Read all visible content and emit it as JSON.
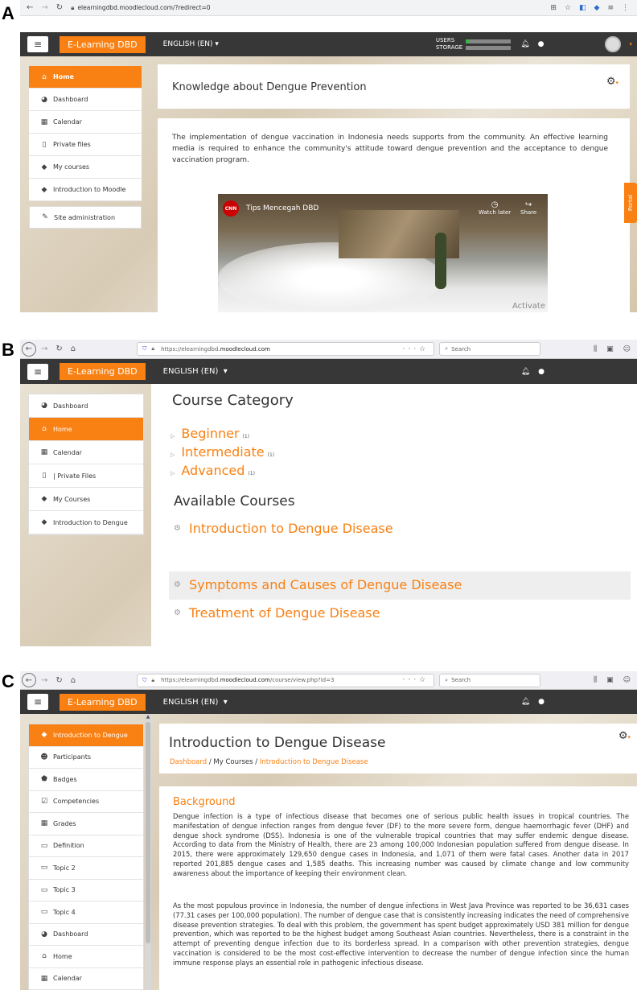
{
  "labels": {
    "a": "A",
    "b": "B",
    "c": "C"
  },
  "panelA": {
    "url": "elearningdbd.moodlecloud.com/?redirect=0",
    "brand": "E-Learning DBD",
    "lang": "ENGLISH (EN)",
    "users_label": "USERS",
    "storage_label": "STORAGE",
    "sidebar": [
      {
        "icon": "home-icon",
        "glyph": "⌂",
        "label": "Home",
        "active": true
      },
      {
        "icon": "dashboard-icon",
        "glyph": "◕",
        "label": "Dashboard"
      },
      {
        "icon": "calendar-icon",
        "glyph": "▦",
        "label": "Calendar"
      },
      {
        "icon": "file-icon",
        "glyph": "▯",
        "label": "Private files"
      },
      {
        "icon": "graduation-cap-icon",
        "glyph": "◆",
        "label": "My courses"
      },
      {
        "icon": "graduation-cap-icon",
        "glyph": "◆",
        "label": "Introduction to Moodle"
      },
      {
        "icon": "wrench-icon",
        "glyph": "✎",
        "label": "Site administration"
      }
    ],
    "page_title": "Knowledge about Dengue Prevention",
    "intro": "The implementation of dengue vaccination in Indonesia needs supports from the community. An effective learning media is required to enhance the community's attitude toward dengue prevention and the acceptance to dengue vaccination program.",
    "video": {
      "channel": "CNN",
      "title": "Tips Mencegah DBD",
      "watch_later": "Watch later",
      "share": "Share",
      "watermark": "Activate"
    },
    "portal_tab": "Portal"
  },
  "panelB": {
    "url_prefix": "https://elearningdbd.",
    "url_domain": "moodlecloud.com",
    "search_placeholder": "Search",
    "brand": "E-Learning DBD",
    "lang": "ENGLISH (EN)",
    "sidebar": [
      {
        "icon": "dashboard-icon",
        "glyph": "◕",
        "label": "Dashboard"
      },
      {
        "icon": "home-icon",
        "glyph": "⌂",
        "label": "Home",
        "active": true
      },
      {
        "icon": "calendar-icon",
        "glyph": "▦",
        "label": "Calendar"
      },
      {
        "icon": "file-icon",
        "glyph": "▯",
        "label": "|  Private Files"
      },
      {
        "icon": "graduation-cap-icon",
        "glyph": "◆",
        "label": "My Courses"
      },
      {
        "icon": "graduation-cap-icon",
        "glyph": "◆",
        "label": "Introduction to Dengue"
      }
    ],
    "category_heading": "Course Category",
    "categories": [
      {
        "name": "Beginner",
        "count": "(1)"
      },
      {
        "name": "Intermediate",
        "count": "(1)"
      },
      {
        "name": "Advanced",
        "count": "(1)"
      }
    ],
    "available_heading": "Available Courses",
    "courses": [
      "Introduction to Dengue Disease",
      "Symptoms and Causes of Dengue Disease",
      "Treatment of  Dengue Disease"
    ]
  },
  "panelC": {
    "url_prefix": "https://elearningdbd.",
    "url_domain": "moodlecloud.com",
    "url_suffix": "/course/view.php?id=3",
    "search_placeholder": "Search",
    "brand": "E-Learning DBD",
    "lang": "ENGLISH (EN)",
    "sidebar": [
      {
        "icon": "graduation-cap-icon",
        "glyph": "◆",
        "label": "Introduction to Dengue",
        "active": true
      },
      {
        "icon": "users-icon",
        "glyph": "☻",
        "label": "Participants"
      },
      {
        "icon": "badge-icon",
        "glyph": "⬟",
        "label": "Badges"
      },
      {
        "icon": "checkbox-icon",
        "glyph": "☑",
        "label": "Competencies"
      },
      {
        "icon": "table-icon",
        "glyph": "▦",
        "label": "Grades"
      },
      {
        "icon": "folder-icon",
        "glyph": "▭",
        "label": "Definition"
      },
      {
        "icon": "folder-icon",
        "glyph": "▭",
        "label": "Topic 2"
      },
      {
        "icon": "folder-icon",
        "glyph": "▭",
        "label": "Topic 3"
      },
      {
        "icon": "folder-icon",
        "glyph": "▭",
        "label": "Topic 4"
      },
      {
        "icon": "dashboard-icon",
        "glyph": "◕",
        "label": "Dashboard"
      },
      {
        "icon": "home-icon",
        "glyph": "⌂",
        "label": "Home"
      },
      {
        "icon": "calendar-icon",
        "glyph": "▦",
        "label": "Calendar"
      }
    ],
    "page_title": "Introduction to Dengue Disease",
    "breadcrumb": {
      "home": "Dashboard",
      "sep": "/",
      "mid": "My Courses",
      "current": "Introduction to Dengue Disease"
    },
    "section_title": "Background",
    "para1": "Dengue infection is a type of infectious disease that becomes one of serious public health issues in tropical countries. The manifestation of dengue infection ranges from dengue fever (DF) to the more severe form, dengue haemorrhagic fever (DHF) and dengue shock syndrome (DSS). Indonesia is one of the vulnerable tropical countries that may suffer endemic dengue disease. According to data from the Ministry of Health, there are 23 among 100,000 Indonesian population suffered from dengue disease. In 2015, there were approximately 129,650 dengue cases in Indonesia, and 1,071 of them were fatal cases. Another data in 2017 reported 201,885 dengue cases and 1,585 deaths. This increasing number was caused by climate change and low community awareness about the importance of keeping their environment clean.",
    "para2": "As the most populous province in Indonesia, the number of dengue infections in West Java Province was reported to be 36,631 cases (77.31 cases per 100,000 population). The number of dengue case that is consistently increasing indicates the need of comprehensive disease prevention strategies. To deal with this problem, the government has spent budget approximately USD 381 million for dengue prevention, which was reported to be the highest budget among Southeast Asian countries. Nevertheless, there is a constraint in the attempt of preventing dengue infection due to its borderless spread. In a comparison with other prevention strategies, dengue vaccination is considered to be the most cost-effective intervention to decrease the number of dengue infection since the human immune response plays an essential role in pathogenic infectious disease."
  }
}
